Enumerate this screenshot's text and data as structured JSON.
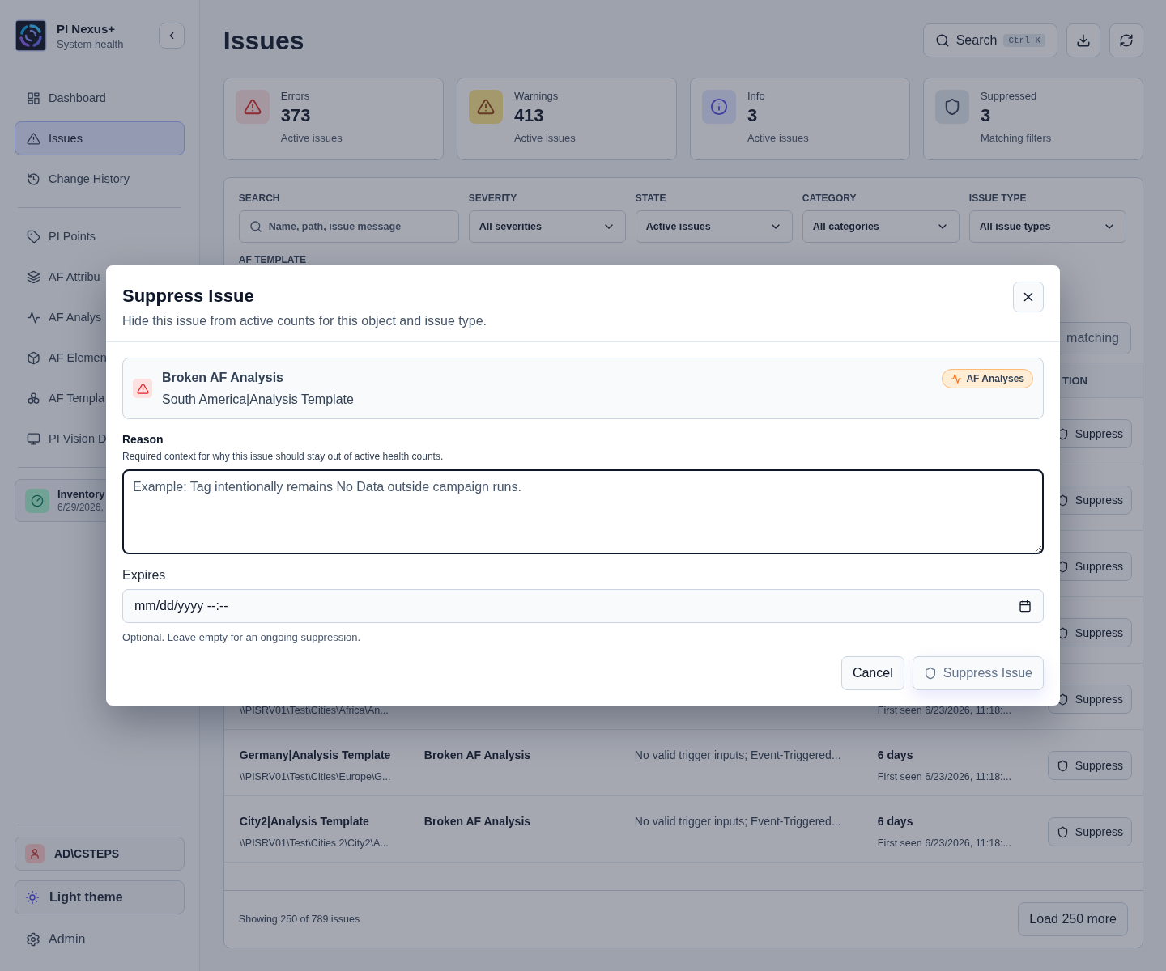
{
  "sidebar": {
    "app_name": "PI Nexus+",
    "app_subtitle": "System health",
    "nav": [
      {
        "label": "Dashboard",
        "selected": false
      },
      {
        "label": "Issues",
        "selected": true
      },
      {
        "label": "Change History",
        "selected": false
      }
    ],
    "objects": [
      {
        "label": "PI Points",
        "selected": false
      },
      {
        "label": "AF Attribu",
        "selected": false
      },
      {
        "label": "AF Analys",
        "selected": false
      },
      {
        "label": "AF Elemen",
        "selected": false
      },
      {
        "label": "AF Templa",
        "selected": false
      },
      {
        "label": "PI Vision D",
        "selected": false
      }
    ],
    "inventory": {
      "title": "Inventory",
      "date": "6/29/2026,"
    },
    "user": "AD\\CSTEPS",
    "theme": "Light theme",
    "admin": "Admin"
  },
  "header": {
    "title": "Issues",
    "search_label": "Search",
    "search_shortcut": "Ctrl K"
  },
  "stats": [
    {
      "kind": "error",
      "label": "Errors",
      "value": "373",
      "caption": "Active issues"
    },
    {
      "kind": "warning",
      "label": "Warnings",
      "value": "413",
      "caption": "Active issues"
    },
    {
      "kind": "info",
      "label": "Info",
      "value": "3",
      "caption": "Active issues"
    },
    {
      "kind": "suppressed",
      "label": "Suppressed",
      "value": "3",
      "caption": "Matching filters"
    }
  ],
  "filters": {
    "fields": [
      {
        "kind": "search",
        "label": "SEARCH",
        "placeholder": "Name, path, issue message"
      },
      {
        "kind": "select",
        "label": "SEVERITY",
        "value": "All severities"
      },
      {
        "kind": "select",
        "label": "STATE",
        "value": "Active issues"
      },
      {
        "kind": "select",
        "label": "CATEGORY",
        "value": "All categories"
      },
      {
        "kind": "select",
        "label": "ISSUE TYPE",
        "value": "All issue types"
      }
    ],
    "af_template_label": "AF TEMPLATE",
    "matching_button": "matching"
  },
  "table": {
    "action_header": "TION",
    "rows": [
      {
        "action": "Suppress"
      },
      {
        "action": "Suppress"
      },
      {
        "action": "Suppress"
      },
      {
        "action": "Suppress"
      },
      {
        "path": "\\\\PISRV01\\Test\\Cities\\Africa\\An...",
        "first_seen": "First seen 6/23/2026, 11:18:...",
        "action": "Suppress"
      },
      {
        "name": "Germany|Analysis Template",
        "path": "\\\\PISRV01\\Test\\Cities\\Europe\\G...",
        "type": "Broken AF Analysis",
        "message": "No valid trigger inputs; Event-Triggered...",
        "age": "6 days",
        "first_seen": "First seen 6/23/2026, 11:18:...",
        "action": "Suppress"
      },
      {
        "name": "City2|Analysis Template",
        "path": "\\\\PISRV01\\Test\\Cities 2\\City2\\A...",
        "type": "Broken AF Analysis",
        "message": "No valid trigger inputs; Event-Triggered...",
        "age": "6 days",
        "first_seen": "First seen 6/23/2026, 11:18:...",
        "action": "Suppress"
      }
    ]
  },
  "footer": {
    "summary": "Showing 250 of 789 issues",
    "load_more": "Load 250 more"
  },
  "dialog": {
    "title": "Suppress Issue",
    "subtitle": "Hide this issue from active counts for this object and issue type.",
    "issue": {
      "kind": "error",
      "type": "Broken AF Analysis",
      "object": "South America|Analysis Template",
      "category": "AF Analyses"
    },
    "reason": {
      "label": "Reason",
      "help": "Required context for why this issue should stay out of active health counts.",
      "placeholder": "Example: Tag intentionally remains No Data outside campaign runs."
    },
    "expires": {
      "label": "Expires",
      "placeholder": "mm/dd/yyyy --:--",
      "help": "Optional. Leave empty for an ongoing suppression."
    },
    "cancel": "Cancel",
    "submit": {
      "label": "Suppress Issue",
      "disabled": true
    }
  }
}
